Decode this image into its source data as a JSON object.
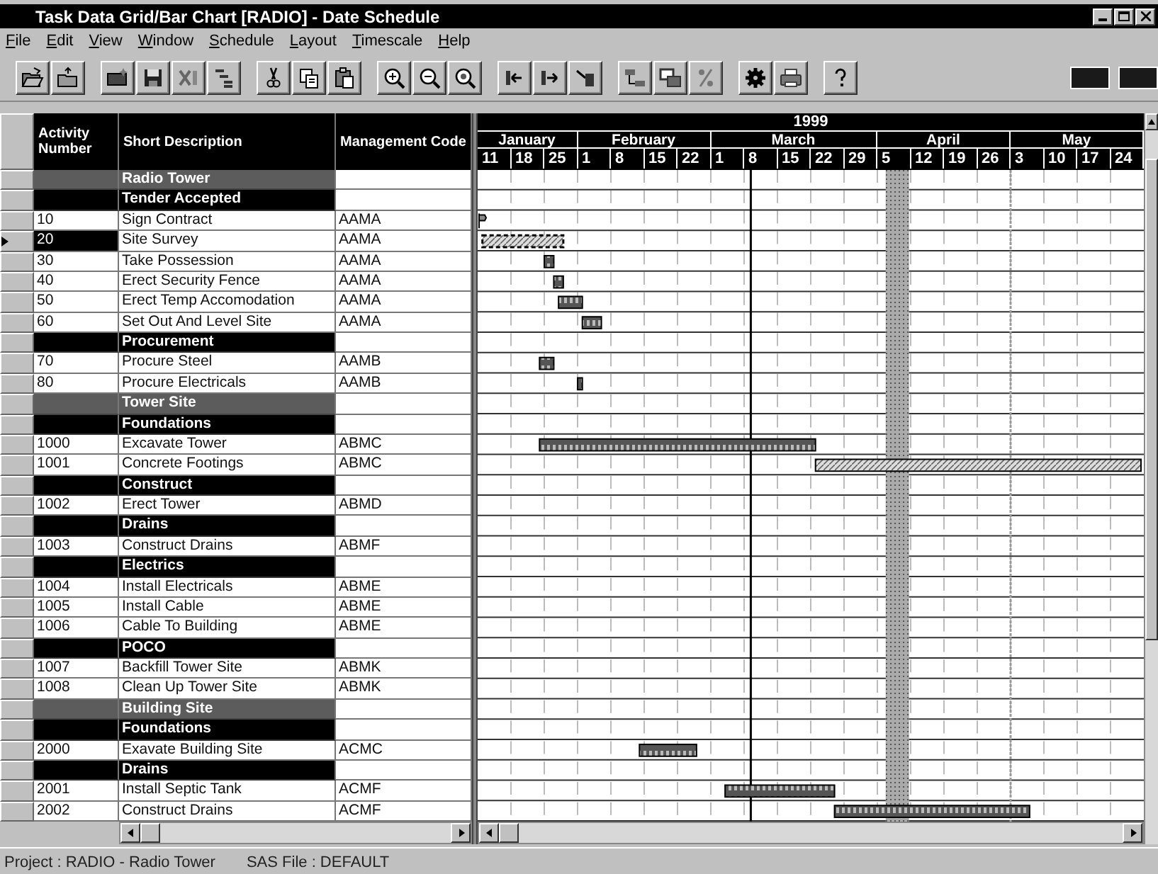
{
  "window": {
    "title": "Task Data Grid/Bar Chart [RADIO] - Date Schedule"
  },
  "menu": [
    "File",
    "Edit",
    "View",
    "Window",
    "Schedule",
    "Layout",
    "Timescale",
    "Help"
  ],
  "table": {
    "columns": [
      "Activity Number",
      "Short Description",
      "Management Code"
    ],
    "rows": [
      {
        "kind": "group",
        "description": "Radio Tower"
      },
      {
        "kind": "subgroup",
        "description": "Tender Accepted"
      },
      {
        "kind": "task",
        "number": "10",
        "description": "Sign Contract",
        "code": "AAMA",
        "selected": false
      },
      {
        "kind": "task",
        "number": "20",
        "description": "Site Survey",
        "code": "AAMA",
        "selected": true
      },
      {
        "kind": "task",
        "number": "30",
        "description": "Take Possession",
        "code": "AAMA",
        "selected": false
      },
      {
        "kind": "task",
        "number": "40",
        "description": "Erect Security Fence",
        "code": "AAMA",
        "selected": false
      },
      {
        "kind": "task",
        "number": "50",
        "description": "Erect Temp Accomodation",
        "code": "AAMA",
        "selected": false
      },
      {
        "kind": "task",
        "number": "60",
        "description": "Set Out And Level Site",
        "code": "AAMA",
        "selected": false
      },
      {
        "kind": "subgroup",
        "description": "Procurement"
      },
      {
        "kind": "task",
        "number": "70",
        "description": "Procure Steel",
        "code": "AAMB",
        "selected": false
      },
      {
        "kind": "task",
        "number": "80",
        "description": "Procure Electricals",
        "code": "AAMB",
        "selected": false
      },
      {
        "kind": "group",
        "description": "Tower Site"
      },
      {
        "kind": "subgroup",
        "description": "Foundations"
      },
      {
        "kind": "task",
        "number": "1000",
        "description": "Excavate Tower",
        "code": "ABMC",
        "selected": false
      },
      {
        "kind": "task",
        "number": "1001",
        "description": "Concrete Footings",
        "code": "ABMC",
        "selected": false
      },
      {
        "kind": "subgroup",
        "description": "Construct"
      },
      {
        "kind": "task",
        "number": "1002",
        "description": "Erect Tower",
        "code": "ABMD",
        "selected": false
      },
      {
        "kind": "subgroup",
        "description": "Drains"
      },
      {
        "kind": "task",
        "number": "1003",
        "description": "Construct Drains",
        "code": "ABMF",
        "selected": false
      },
      {
        "kind": "subgroup",
        "description": "Electrics"
      },
      {
        "kind": "task",
        "number": "1004",
        "description": "Install Electricals",
        "code": "ABME",
        "selected": false
      },
      {
        "kind": "task",
        "number": "1005",
        "description": "Install Cable",
        "code": "ABME",
        "selected": false
      },
      {
        "kind": "task",
        "number": "1006",
        "description": "Cable To Building",
        "code": "ABME",
        "selected": false
      },
      {
        "kind": "subgroup",
        "description": "POCO"
      },
      {
        "kind": "task",
        "number": "1007",
        "description": "Backfill Tower Site",
        "code": "ABMK",
        "selected": false
      },
      {
        "kind": "task",
        "number": "1008",
        "description": "Clean Up Tower Site",
        "code": "ABMK",
        "selected": false
      },
      {
        "kind": "group",
        "description": "Building Site"
      },
      {
        "kind": "subgroup",
        "description": "Foundations"
      },
      {
        "kind": "task",
        "number": "2000",
        "description": "Exavate Building Site",
        "code": "ACMC",
        "selected": false
      },
      {
        "kind": "subgroup",
        "description": "Drains"
      },
      {
        "kind": "task",
        "number": "2001",
        "description": "Install Septic Tank",
        "code": "ACMF",
        "selected": false
      },
      {
        "kind": "task",
        "number": "2002",
        "description": "Construct Drains",
        "code": "ACMF",
        "selected": false
      }
    ]
  },
  "timescale": {
    "year": "1999",
    "months": [
      {
        "label": "January",
        "days": [
          "11",
          "18",
          "25"
        ]
      },
      {
        "label": "February",
        "days": [
          "1",
          "8",
          "15",
          "22"
        ]
      },
      {
        "label": "March",
        "days": [
          "1",
          "8",
          "15",
          "22",
          "29"
        ]
      },
      {
        "label": "April",
        "days": [
          "5",
          "12",
          "19",
          "26"
        ]
      },
      {
        "label": "May",
        "days": [
          "3",
          "10",
          "17",
          "24"
        ]
      }
    ]
  },
  "status_bar": [
    "Project : RADIO - Radio Tower",
    "SAS File : DEFAULT"
  ]
}
